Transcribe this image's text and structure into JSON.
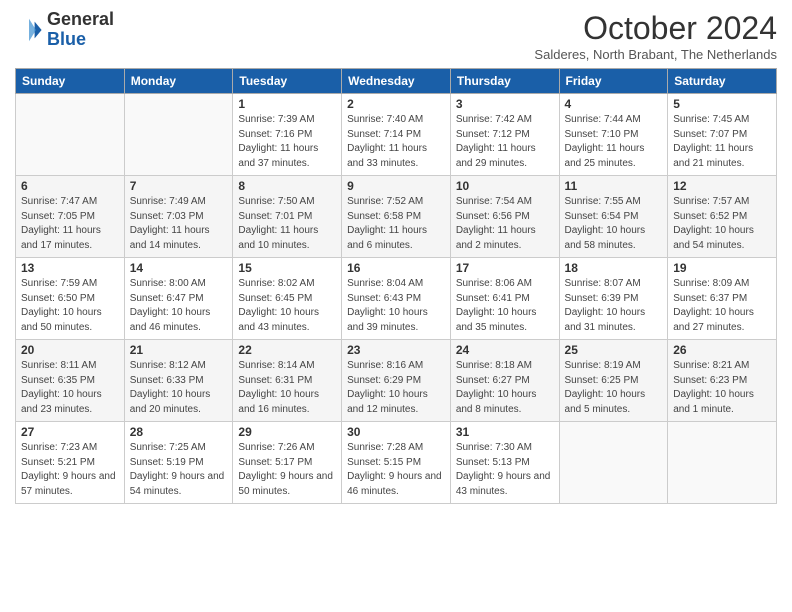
{
  "header": {
    "logo_line1": "General",
    "logo_line2": "Blue",
    "month": "October 2024",
    "location": "Salderes, North Brabant, The Netherlands"
  },
  "days_of_week": [
    "Sunday",
    "Monday",
    "Tuesday",
    "Wednesday",
    "Thursday",
    "Friday",
    "Saturday"
  ],
  "weeks": [
    [
      {
        "num": "",
        "info": ""
      },
      {
        "num": "",
        "info": ""
      },
      {
        "num": "1",
        "info": "Sunrise: 7:39 AM\nSunset: 7:16 PM\nDaylight: 11 hours and 37 minutes."
      },
      {
        "num": "2",
        "info": "Sunrise: 7:40 AM\nSunset: 7:14 PM\nDaylight: 11 hours and 33 minutes."
      },
      {
        "num": "3",
        "info": "Sunrise: 7:42 AM\nSunset: 7:12 PM\nDaylight: 11 hours and 29 minutes."
      },
      {
        "num": "4",
        "info": "Sunrise: 7:44 AM\nSunset: 7:10 PM\nDaylight: 11 hours and 25 minutes."
      },
      {
        "num": "5",
        "info": "Sunrise: 7:45 AM\nSunset: 7:07 PM\nDaylight: 11 hours and 21 minutes."
      }
    ],
    [
      {
        "num": "6",
        "info": "Sunrise: 7:47 AM\nSunset: 7:05 PM\nDaylight: 11 hours and 17 minutes."
      },
      {
        "num": "7",
        "info": "Sunrise: 7:49 AM\nSunset: 7:03 PM\nDaylight: 11 hours and 14 minutes."
      },
      {
        "num": "8",
        "info": "Sunrise: 7:50 AM\nSunset: 7:01 PM\nDaylight: 11 hours and 10 minutes."
      },
      {
        "num": "9",
        "info": "Sunrise: 7:52 AM\nSunset: 6:58 PM\nDaylight: 11 hours and 6 minutes."
      },
      {
        "num": "10",
        "info": "Sunrise: 7:54 AM\nSunset: 6:56 PM\nDaylight: 11 hours and 2 minutes."
      },
      {
        "num": "11",
        "info": "Sunrise: 7:55 AM\nSunset: 6:54 PM\nDaylight: 10 hours and 58 minutes."
      },
      {
        "num": "12",
        "info": "Sunrise: 7:57 AM\nSunset: 6:52 PM\nDaylight: 10 hours and 54 minutes."
      }
    ],
    [
      {
        "num": "13",
        "info": "Sunrise: 7:59 AM\nSunset: 6:50 PM\nDaylight: 10 hours and 50 minutes."
      },
      {
        "num": "14",
        "info": "Sunrise: 8:00 AM\nSunset: 6:47 PM\nDaylight: 10 hours and 46 minutes."
      },
      {
        "num": "15",
        "info": "Sunrise: 8:02 AM\nSunset: 6:45 PM\nDaylight: 10 hours and 43 minutes."
      },
      {
        "num": "16",
        "info": "Sunrise: 8:04 AM\nSunset: 6:43 PM\nDaylight: 10 hours and 39 minutes."
      },
      {
        "num": "17",
        "info": "Sunrise: 8:06 AM\nSunset: 6:41 PM\nDaylight: 10 hours and 35 minutes."
      },
      {
        "num": "18",
        "info": "Sunrise: 8:07 AM\nSunset: 6:39 PM\nDaylight: 10 hours and 31 minutes."
      },
      {
        "num": "19",
        "info": "Sunrise: 8:09 AM\nSunset: 6:37 PM\nDaylight: 10 hours and 27 minutes."
      }
    ],
    [
      {
        "num": "20",
        "info": "Sunrise: 8:11 AM\nSunset: 6:35 PM\nDaylight: 10 hours and 23 minutes."
      },
      {
        "num": "21",
        "info": "Sunrise: 8:12 AM\nSunset: 6:33 PM\nDaylight: 10 hours and 20 minutes."
      },
      {
        "num": "22",
        "info": "Sunrise: 8:14 AM\nSunset: 6:31 PM\nDaylight: 10 hours and 16 minutes."
      },
      {
        "num": "23",
        "info": "Sunrise: 8:16 AM\nSunset: 6:29 PM\nDaylight: 10 hours and 12 minutes."
      },
      {
        "num": "24",
        "info": "Sunrise: 8:18 AM\nSunset: 6:27 PM\nDaylight: 10 hours and 8 minutes."
      },
      {
        "num": "25",
        "info": "Sunrise: 8:19 AM\nSunset: 6:25 PM\nDaylight: 10 hours and 5 minutes."
      },
      {
        "num": "26",
        "info": "Sunrise: 8:21 AM\nSunset: 6:23 PM\nDaylight: 10 hours and 1 minute."
      }
    ],
    [
      {
        "num": "27",
        "info": "Sunrise: 7:23 AM\nSunset: 5:21 PM\nDaylight: 9 hours and 57 minutes."
      },
      {
        "num": "28",
        "info": "Sunrise: 7:25 AM\nSunset: 5:19 PM\nDaylight: 9 hours and 54 minutes."
      },
      {
        "num": "29",
        "info": "Sunrise: 7:26 AM\nSunset: 5:17 PM\nDaylight: 9 hours and 50 minutes."
      },
      {
        "num": "30",
        "info": "Sunrise: 7:28 AM\nSunset: 5:15 PM\nDaylight: 9 hours and 46 minutes."
      },
      {
        "num": "31",
        "info": "Sunrise: 7:30 AM\nSunset: 5:13 PM\nDaylight: 9 hours and 43 minutes."
      },
      {
        "num": "",
        "info": ""
      },
      {
        "num": "",
        "info": ""
      }
    ]
  ]
}
